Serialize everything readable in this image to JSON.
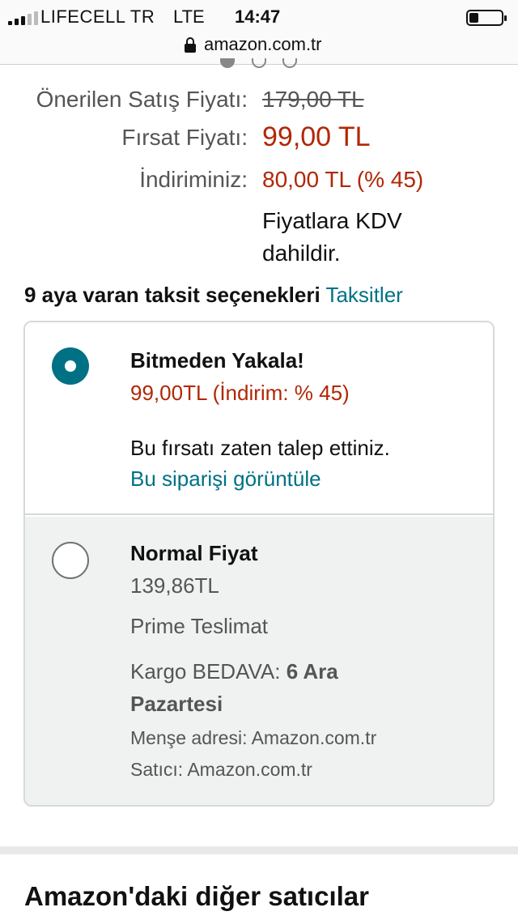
{
  "status_bar": {
    "carrier": "LIFECELL TR",
    "network": "LTE",
    "time": "14:47",
    "signal_bars_filled": 3,
    "signal_bars_total": 5
  },
  "url_bar": {
    "url": "amazon.com.tr",
    "icon": "lock-icon"
  },
  "carousel": {
    "pages": 3,
    "active_index": 0
  },
  "pricing": {
    "list_label": "Önerilen Satış Fiyatı:",
    "list_value": "179,00 TL",
    "deal_label": "Fırsat Fiyatı:",
    "deal_value": "99,00 TL",
    "savings_label": "İndiriminiz:",
    "savings_value": "80,00 TL (% 45)",
    "vat_note_line1": "Fiyatlara KDV",
    "vat_note_line2": "dahildir."
  },
  "installments": {
    "text": "9 aya varan taksit seçenekleri",
    "link": "Taksitler"
  },
  "options": [
    {
      "selected": true,
      "title": "Bitmeden Yakala!",
      "price": "99,00TL (İndirim: % 45)",
      "note": "Bu fırsatı zaten talep ettiniz.",
      "link": "Bu siparişi görüntüle"
    },
    {
      "selected": false,
      "title": "Normal Fiyat",
      "price": "139,86TL",
      "delivery": "Prime Teslimat",
      "shipping_prefix": "Kargo BEDAVA: ",
      "shipping_date_line1": "6 Ara",
      "shipping_date_line2": "Pazartesi",
      "ships_from": "Menşe adresi: Amazon.com.tr",
      "sold_by": "Satıcı: Amazon.com.tr"
    }
  ],
  "other_sellers": {
    "title": "Amazon'daki diğer satıcılar"
  },
  "colors": {
    "price_red": "#b12704",
    "link_teal": "#007185",
    "radio_selected": "#007185",
    "option_bg": "#f0f2f2",
    "border": "#d5d9d9"
  }
}
